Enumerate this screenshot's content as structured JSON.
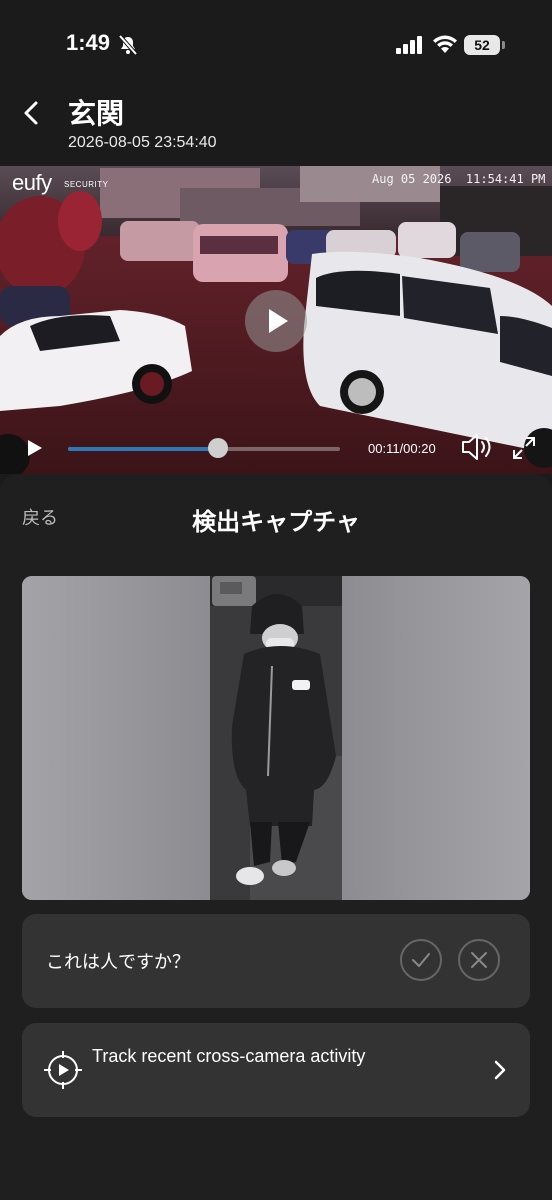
{
  "status_bar": {
    "time": "1:49",
    "battery": "52",
    "icons": [
      "bell-off-icon",
      "signal-icon",
      "wifi-icon",
      "battery-icon"
    ]
  },
  "header": {
    "title": "玄関",
    "subtitle": "2026-08-05 23:54:40",
    "back_icon": "chevron-left-icon"
  },
  "video": {
    "brand": "eufy",
    "brand_sub": "SECURITY",
    "osd_timestamp": "Aug 05 2026  11:54:41 PM",
    "time_readout": "00:11/00:20",
    "progress": 0.55,
    "controls": [
      "play-icon",
      "speaker-icon",
      "fullscreen-icon"
    ]
  },
  "sheet": {
    "back_label": "戻る",
    "title": "検出キャプチャ",
    "question": "これは人ですか？",
    "track_label": "Track recent cross-camera activity",
    "colors": {
      "accent": "#2f78b8",
      "card": "#333333",
      "sheet": "#1f1f1f"
    }
  }
}
